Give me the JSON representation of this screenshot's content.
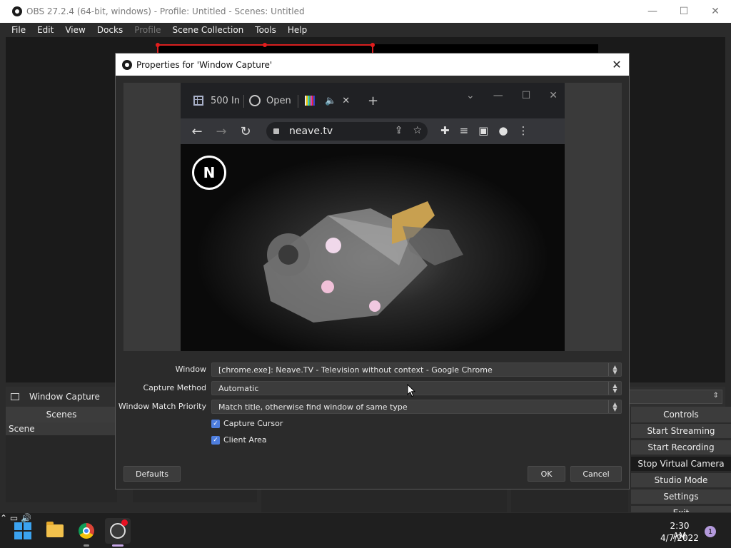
{
  "obs": {
    "title": "OBS 27.2.4 (64-bit, windows) - Profile: Untitled - Scenes: Untitled",
    "menu": [
      "File",
      "Edit",
      "View",
      "Docks",
      "Profile",
      "Scene Collection",
      "Tools",
      "Help"
    ],
    "menu_disabled": [
      "Profile"
    ],
    "source_toolbar_name": "Window Capture",
    "scenes_header": "Scenes",
    "scenes": [
      "Scene"
    ],
    "controls_header": "Controls",
    "controls": [
      "Start Streaming",
      "Start Recording",
      "Stop Virtual Camera",
      "Studio Mode",
      "Settings",
      "Exit"
    ],
    "window_controls": {
      "minimize": "—",
      "maximize": "☐",
      "close": "✕"
    }
  },
  "dialog": {
    "title": "Properties for 'Window Capture'",
    "close": "✕",
    "fields": [
      {
        "label": "Window",
        "value": "[chrome.exe]: Neave.TV - Television without context - Google Chrome"
      },
      {
        "label": "Capture Method",
        "value": "Automatic"
      },
      {
        "label": "Window Match Priority",
        "value": "Match title, otherwise find window of same type"
      }
    ],
    "checkboxes": [
      {
        "label": "Capture Cursor",
        "checked": true
      },
      {
        "label": "Client Area",
        "checked": true
      }
    ],
    "buttons": {
      "defaults": "Defaults",
      "ok": "OK",
      "cancel": "Cancel"
    }
  },
  "captured_chrome": {
    "tabs": [
      {
        "label": "500 In",
        "icon": "grid-icon"
      },
      {
        "label": "Open",
        "icon": "openai-icon"
      },
      {
        "label": "",
        "icon": "tv-test-pattern-icon"
      }
    ],
    "new_tab": "+",
    "url": "neave.tv",
    "logo_text": "N"
  },
  "taskbar": {
    "apps": [
      "start-icon",
      "file-explorer-icon",
      "chrome-icon",
      "obs-icon"
    ],
    "time": "2:30 AM",
    "date": "4/7/2022",
    "notifications": "1"
  },
  "colors": {
    "accent_check": "#4e7ede",
    "selection_red": "#d81f1f",
    "obs_bg": "#2b2b2b"
  }
}
